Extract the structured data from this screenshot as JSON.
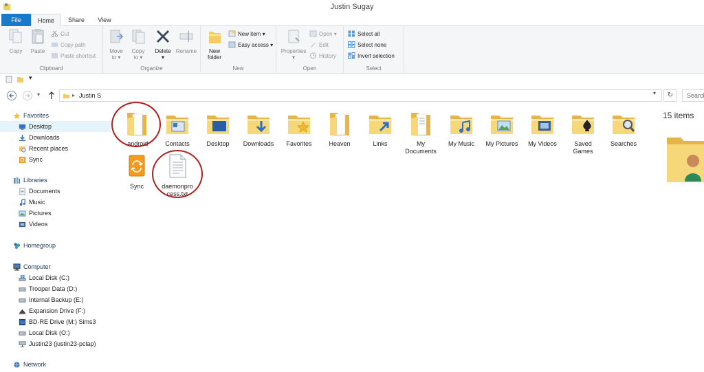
{
  "window": {
    "title": "Justin Sugay"
  },
  "ribbon_tabs": [
    "File",
    "Home",
    "Share",
    "View"
  ],
  "ribbon": {
    "clipboard": {
      "label": "Clipboard",
      "copy": "Copy",
      "paste": "Paste",
      "cut": "Cut",
      "copy_path": "Copy path",
      "paste_shortcut": "Paste shortcut"
    },
    "organize": {
      "label": "Organize",
      "move_to_line1": "Move",
      "move_to_line2": "to ▾",
      "copy_to_line1": "Copy",
      "copy_to_line2": "to ▾",
      "delete_line1": "Delete",
      "delete_line2": "▾",
      "rename": "Rename"
    },
    "new": {
      "label": "New",
      "new_folder_line1": "New",
      "new_folder_line2": "folder",
      "new_item": "New item ▾",
      "easy_access": "Easy access ▾"
    },
    "open": {
      "label": "Open",
      "properties_line1": "Properties",
      "properties_line2": "▾",
      "open": "Open ▾",
      "edit": "Edit",
      "history": "History"
    },
    "select": {
      "label": "Select",
      "select_all": "Select all",
      "select_none": "Select none",
      "invert_selection": "Invert selection"
    }
  },
  "quick_access": {
    "dropdown": "▾"
  },
  "address": {
    "path": "Justin S",
    "separator": "▸",
    "dropdown": "▾",
    "refresh": "↻",
    "search_placeholder": "Search"
  },
  "nav": {
    "favorites": "Favorites",
    "desktop": "Desktop",
    "downloads": "Downloads",
    "recent_places": "Recent places",
    "sync": "Sync",
    "libraries": "Libraries",
    "documents": "Documents",
    "music": "Music",
    "pictures": "Pictures",
    "videos": "Videos",
    "homegroup": "Homegroup",
    "computer": "Computer",
    "local_disk_c": "Local Disk (C:)",
    "trooper_data": "Trooper Data (D:)",
    "internal_backup": "Internal Backup (E:)",
    "expansion_drive": "Expansion Drive (F:)",
    "bd_re_drive": "BD-RE Drive (M:) Sims3",
    "local_disk_o": "Local Disk (O:)",
    "justin23": "Justin23 (justin23-pclap)",
    "network": "Network"
  },
  "files": {
    "android": ".android",
    "contacts": "Contacts",
    "desktop": "Desktop",
    "downloads": "Downloads",
    "favorites": "Favorites",
    "heaven": "Heaven",
    "links": "Links",
    "my_documents_line1": "My",
    "my_documents_line2": "Documents",
    "my_music": "My Music",
    "my_pictures": "My Pictures",
    "my_videos": "My Videos",
    "saved_games_line1": "Saved",
    "saved_games_line2": "Games",
    "searches": "Searches",
    "sync": "Sync",
    "daemon_line1": "daemonpro",
    "daemon_line2": "cess.txt"
  },
  "details": {
    "item_count": "15 items"
  },
  "colors": {
    "accent": "#1979ca",
    "folder": "#f3cc63",
    "annotation": "#b01e1e"
  }
}
